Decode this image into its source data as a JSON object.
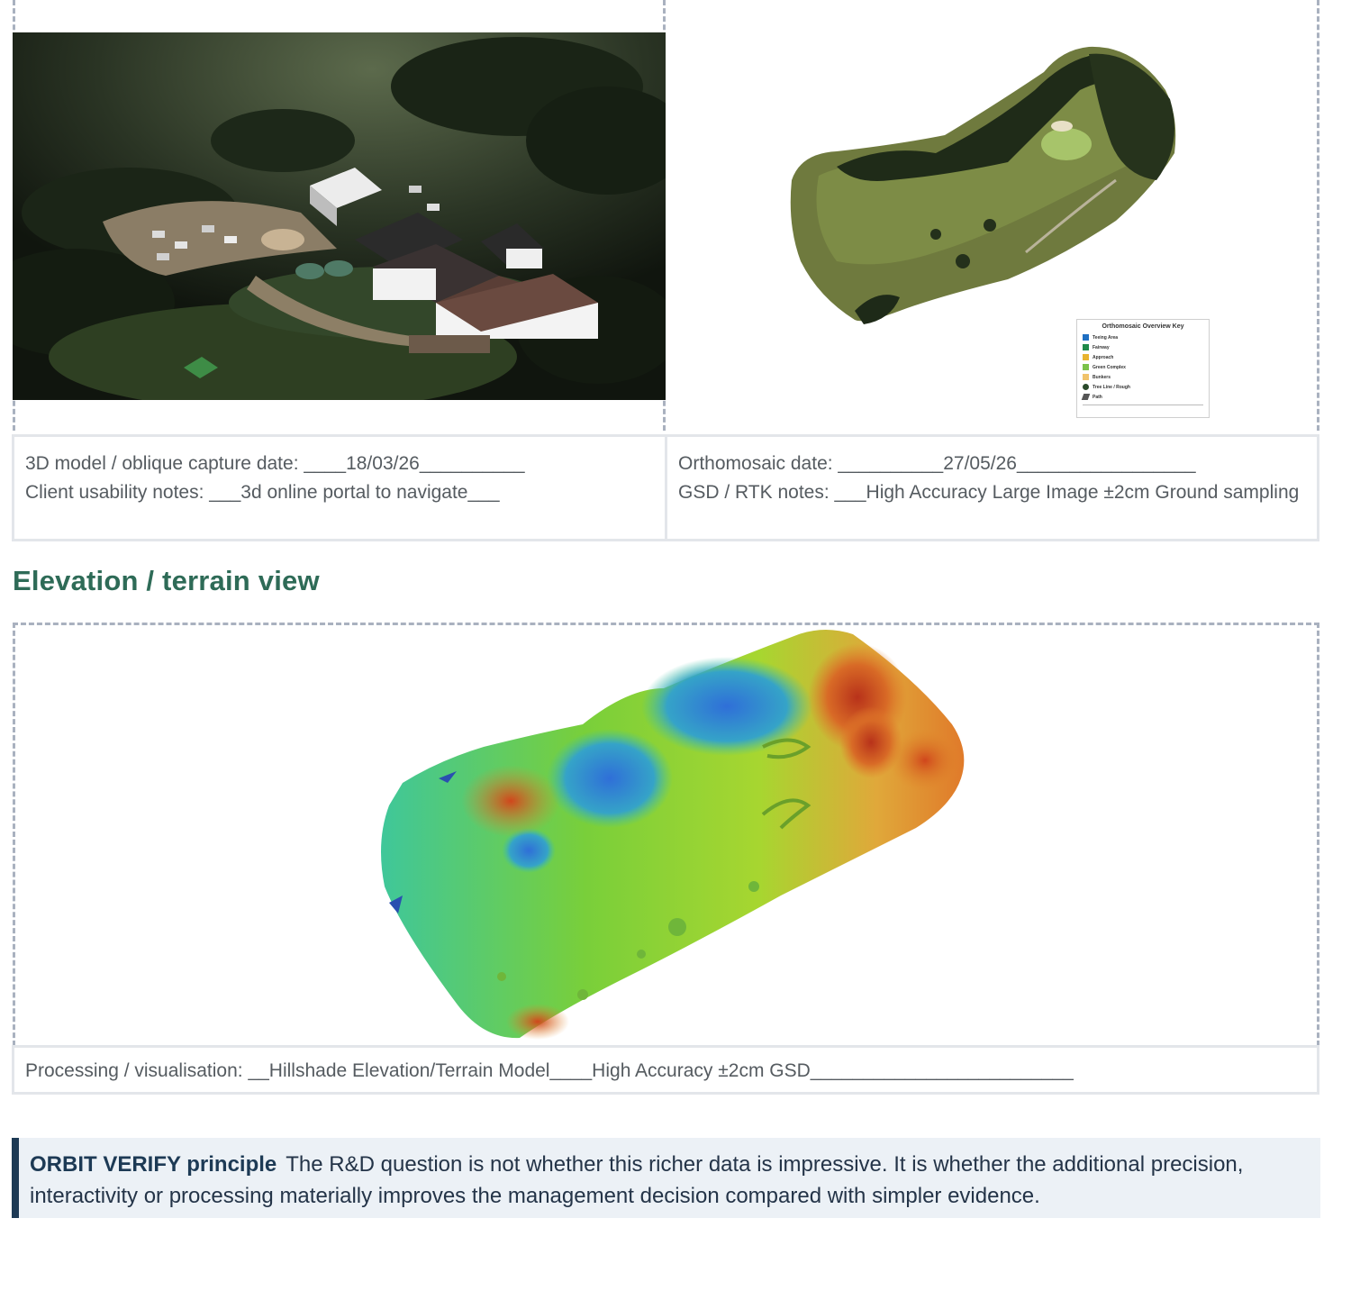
{
  "left_capture": {
    "line1": "3D model / oblique capture date: ____18/03/26__________",
    "line2": "Client usability notes: ___3d online portal to navigate___"
  },
  "right_capture": {
    "line1": "Orthomosaic date: __________27/05/26_________________",
    "line2": "GSD / RTK notes: ___High Accuracy Large Image ±2cm Ground sampling"
  },
  "ortho_key": {
    "title": "Orthomosaic Overview Key",
    "items": [
      {
        "label": "Teeing Area",
        "color": "#1f6fc2"
      },
      {
        "label": "Fairway",
        "color": "#1f8a4a"
      },
      {
        "label": "Approach",
        "color": "#e8b430"
      },
      {
        "label": "Green Complex",
        "color": "#7cc24a"
      },
      {
        "label": "Bunkers",
        "color": "#f0c36a"
      },
      {
        "label": "Tree Line / Rough",
        "color": "#2a4a2a"
      },
      {
        "label": "Path",
        "color": "#555555"
      }
    ]
  },
  "elevation": {
    "heading": "Elevation / terrain view",
    "notes": "Processing / visualisation: __Hillshade Elevation/Terrain  Model____High Accuracy ±2cm GSD_________________________"
  },
  "principle": {
    "label": "ORBIT VERIFY principle",
    "text": "The R&D question is not whether this richer data is impressive. It is whether the additional precision, interactivity or processing materially improves the management decision compared with simpler evidence."
  },
  "colors": {
    "heading": "#2e6b57",
    "callout_bar": "#1d3a55",
    "callout_bg": "#ecf1f6",
    "dashed_border": "#a9b1bf"
  }
}
